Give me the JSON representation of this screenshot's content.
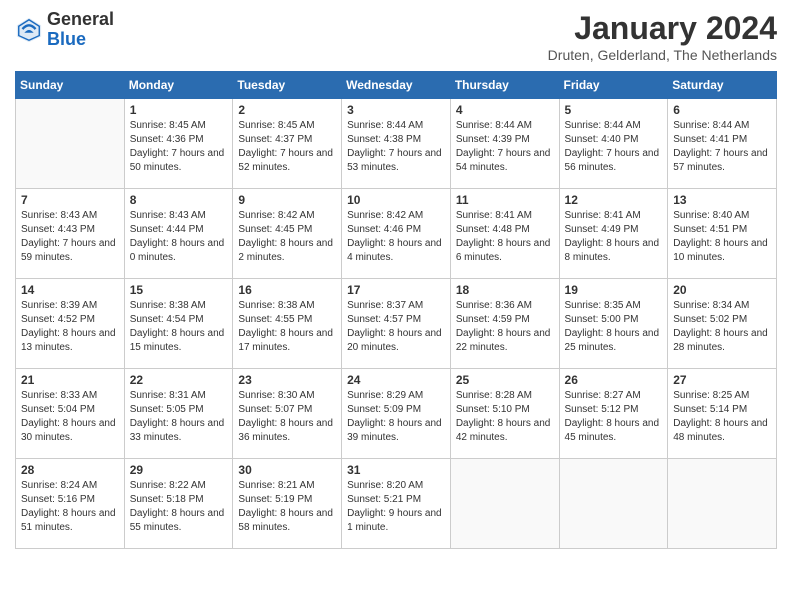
{
  "header": {
    "logo_general": "General",
    "logo_blue": "Blue",
    "month_title": "January 2024",
    "location": "Druten, Gelderland, The Netherlands"
  },
  "weekdays": [
    "Sunday",
    "Monday",
    "Tuesday",
    "Wednesday",
    "Thursday",
    "Friday",
    "Saturday"
  ],
  "weeks": [
    [
      {
        "day": "",
        "empty": true
      },
      {
        "day": "1",
        "sunrise": "Sunrise: 8:45 AM",
        "sunset": "Sunset: 4:36 PM",
        "daylight": "Daylight: 7 hours and 50 minutes."
      },
      {
        "day": "2",
        "sunrise": "Sunrise: 8:45 AM",
        "sunset": "Sunset: 4:37 PM",
        "daylight": "Daylight: 7 hours and 52 minutes."
      },
      {
        "day": "3",
        "sunrise": "Sunrise: 8:44 AM",
        "sunset": "Sunset: 4:38 PM",
        "daylight": "Daylight: 7 hours and 53 minutes."
      },
      {
        "day": "4",
        "sunrise": "Sunrise: 8:44 AM",
        "sunset": "Sunset: 4:39 PM",
        "daylight": "Daylight: 7 hours and 54 minutes."
      },
      {
        "day": "5",
        "sunrise": "Sunrise: 8:44 AM",
        "sunset": "Sunset: 4:40 PM",
        "daylight": "Daylight: 7 hours and 56 minutes."
      },
      {
        "day": "6",
        "sunrise": "Sunrise: 8:44 AM",
        "sunset": "Sunset: 4:41 PM",
        "daylight": "Daylight: 7 hours and 57 minutes."
      }
    ],
    [
      {
        "day": "7",
        "sunrise": "Sunrise: 8:43 AM",
        "sunset": "Sunset: 4:43 PM",
        "daylight": "Daylight: 7 hours and 59 minutes."
      },
      {
        "day": "8",
        "sunrise": "Sunrise: 8:43 AM",
        "sunset": "Sunset: 4:44 PM",
        "daylight": "Daylight: 8 hours and 0 minutes."
      },
      {
        "day": "9",
        "sunrise": "Sunrise: 8:42 AM",
        "sunset": "Sunset: 4:45 PM",
        "daylight": "Daylight: 8 hours and 2 minutes."
      },
      {
        "day": "10",
        "sunrise": "Sunrise: 8:42 AM",
        "sunset": "Sunset: 4:46 PM",
        "daylight": "Daylight: 8 hours and 4 minutes."
      },
      {
        "day": "11",
        "sunrise": "Sunrise: 8:41 AM",
        "sunset": "Sunset: 4:48 PM",
        "daylight": "Daylight: 8 hours and 6 minutes."
      },
      {
        "day": "12",
        "sunrise": "Sunrise: 8:41 AM",
        "sunset": "Sunset: 4:49 PM",
        "daylight": "Daylight: 8 hours and 8 minutes."
      },
      {
        "day": "13",
        "sunrise": "Sunrise: 8:40 AM",
        "sunset": "Sunset: 4:51 PM",
        "daylight": "Daylight: 8 hours and 10 minutes."
      }
    ],
    [
      {
        "day": "14",
        "sunrise": "Sunrise: 8:39 AM",
        "sunset": "Sunset: 4:52 PM",
        "daylight": "Daylight: 8 hours and 13 minutes."
      },
      {
        "day": "15",
        "sunrise": "Sunrise: 8:38 AM",
        "sunset": "Sunset: 4:54 PM",
        "daylight": "Daylight: 8 hours and 15 minutes."
      },
      {
        "day": "16",
        "sunrise": "Sunrise: 8:38 AM",
        "sunset": "Sunset: 4:55 PM",
        "daylight": "Daylight: 8 hours and 17 minutes."
      },
      {
        "day": "17",
        "sunrise": "Sunrise: 8:37 AM",
        "sunset": "Sunset: 4:57 PM",
        "daylight": "Daylight: 8 hours and 20 minutes."
      },
      {
        "day": "18",
        "sunrise": "Sunrise: 8:36 AM",
        "sunset": "Sunset: 4:59 PM",
        "daylight": "Daylight: 8 hours and 22 minutes."
      },
      {
        "day": "19",
        "sunrise": "Sunrise: 8:35 AM",
        "sunset": "Sunset: 5:00 PM",
        "daylight": "Daylight: 8 hours and 25 minutes."
      },
      {
        "day": "20",
        "sunrise": "Sunrise: 8:34 AM",
        "sunset": "Sunset: 5:02 PM",
        "daylight": "Daylight: 8 hours and 28 minutes."
      }
    ],
    [
      {
        "day": "21",
        "sunrise": "Sunrise: 8:33 AM",
        "sunset": "Sunset: 5:04 PM",
        "daylight": "Daylight: 8 hours and 30 minutes."
      },
      {
        "day": "22",
        "sunrise": "Sunrise: 8:31 AM",
        "sunset": "Sunset: 5:05 PM",
        "daylight": "Daylight: 8 hours and 33 minutes."
      },
      {
        "day": "23",
        "sunrise": "Sunrise: 8:30 AM",
        "sunset": "Sunset: 5:07 PM",
        "daylight": "Daylight: 8 hours and 36 minutes."
      },
      {
        "day": "24",
        "sunrise": "Sunrise: 8:29 AM",
        "sunset": "Sunset: 5:09 PM",
        "daylight": "Daylight: 8 hours and 39 minutes."
      },
      {
        "day": "25",
        "sunrise": "Sunrise: 8:28 AM",
        "sunset": "Sunset: 5:10 PM",
        "daylight": "Daylight: 8 hours and 42 minutes."
      },
      {
        "day": "26",
        "sunrise": "Sunrise: 8:27 AM",
        "sunset": "Sunset: 5:12 PM",
        "daylight": "Daylight: 8 hours and 45 minutes."
      },
      {
        "day": "27",
        "sunrise": "Sunrise: 8:25 AM",
        "sunset": "Sunset: 5:14 PM",
        "daylight": "Daylight: 8 hours and 48 minutes."
      }
    ],
    [
      {
        "day": "28",
        "sunrise": "Sunrise: 8:24 AM",
        "sunset": "Sunset: 5:16 PM",
        "daylight": "Daylight: 8 hours and 51 minutes."
      },
      {
        "day": "29",
        "sunrise": "Sunrise: 8:22 AM",
        "sunset": "Sunset: 5:18 PM",
        "daylight": "Daylight: 8 hours and 55 minutes."
      },
      {
        "day": "30",
        "sunrise": "Sunrise: 8:21 AM",
        "sunset": "Sunset: 5:19 PM",
        "daylight": "Daylight: 8 hours and 58 minutes."
      },
      {
        "day": "31",
        "sunrise": "Sunrise: 8:20 AM",
        "sunset": "Sunset: 5:21 PM",
        "daylight": "Daylight: 9 hours and 1 minute."
      },
      {
        "day": "",
        "empty": true
      },
      {
        "day": "",
        "empty": true
      },
      {
        "day": "",
        "empty": true
      }
    ]
  ]
}
